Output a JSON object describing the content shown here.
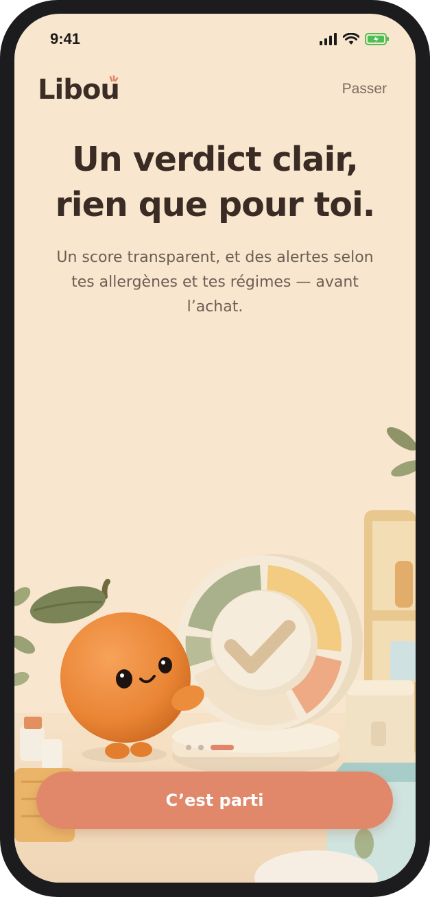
{
  "status_bar": {
    "time": "9:41"
  },
  "header": {
    "brand": "Libou",
    "skip_label": "Passer"
  },
  "onboarding": {
    "headline_line1": "Un verdict clair,",
    "headline_line2": "rien que pour toi.",
    "subtitle_line1": "Un score transparent, et des alertes selon",
    "subtitle_line2": "tes allergènes et tes régimes — avant",
    "subtitle_line3": "l’achat.",
    "current_page": 3,
    "total_pages": 3
  },
  "cta": {
    "label": "C’est parti"
  },
  "colors": {
    "background": "#f8e6ce",
    "accent": "#e2886a",
    "text_dark": "#3a2c24",
    "text_muted": "#6d5e55",
    "score_green": "#a9b08c",
    "score_yellow": "#f3cc82",
    "score_orange": "#eeaa85"
  },
  "icons": [
    "signal-icon",
    "wifi-icon",
    "battery-icon",
    "orange-mascot",
    "score-dial-check-icon"
  ]
}
